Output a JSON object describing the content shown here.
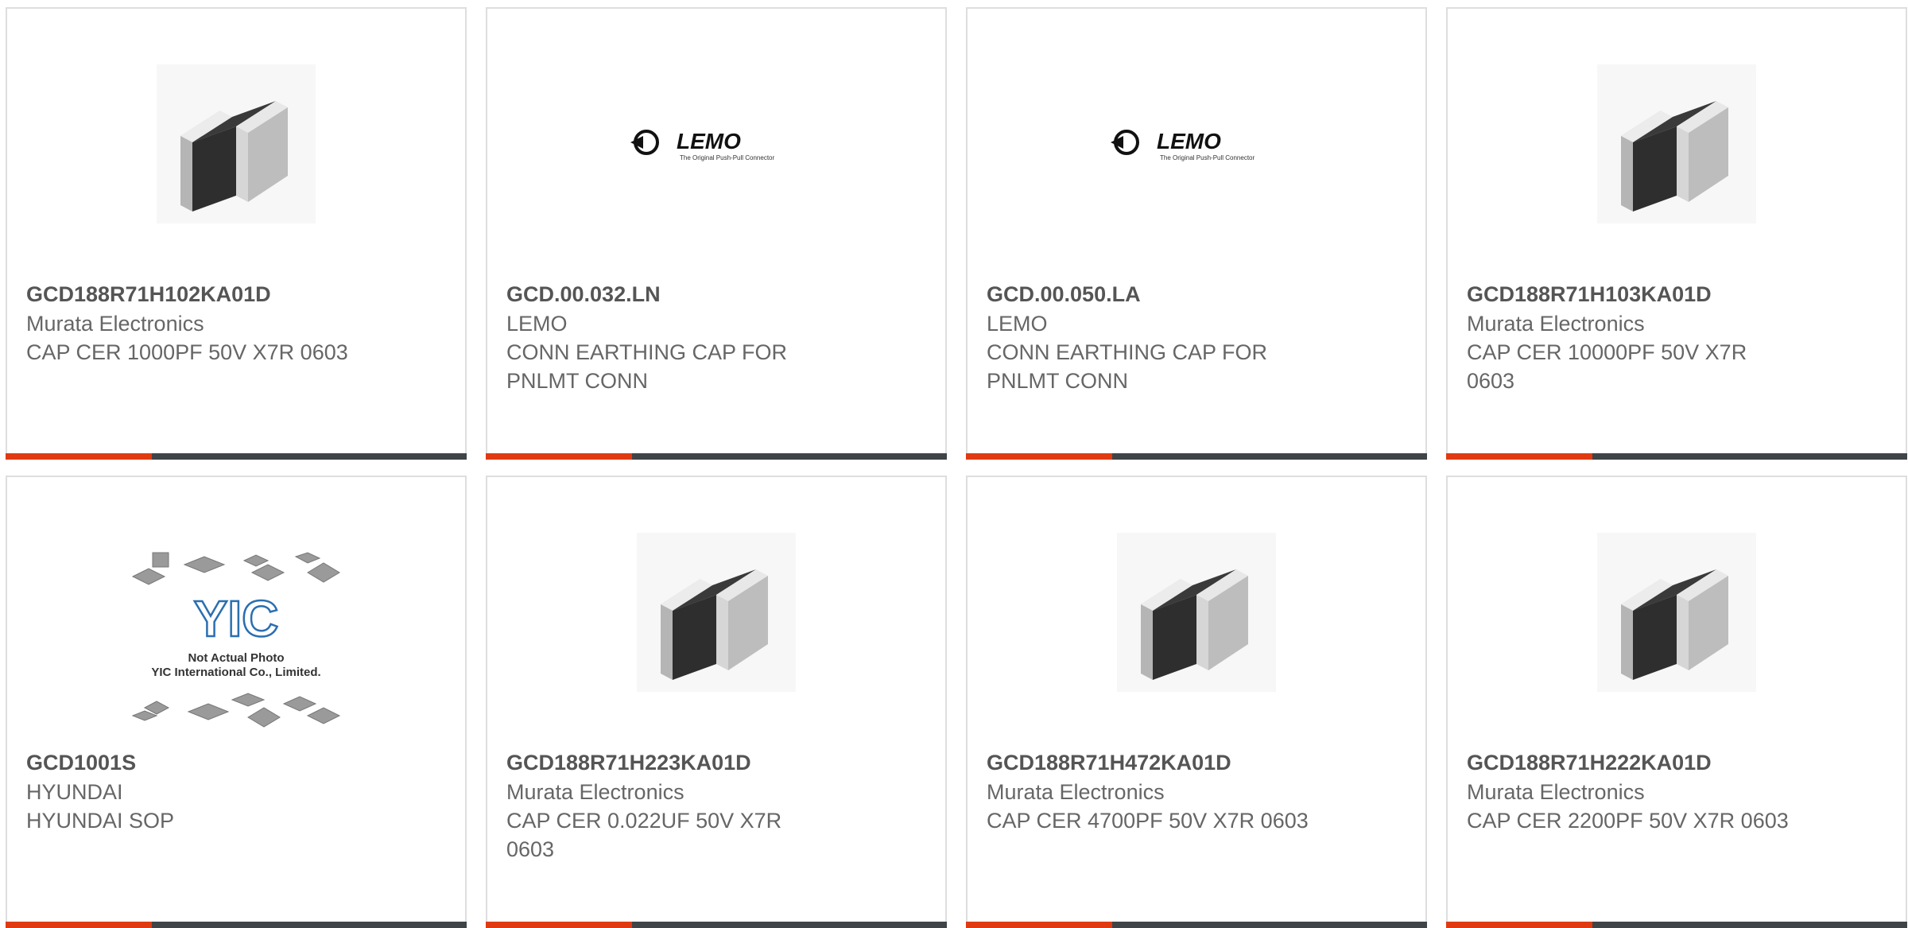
{
  "products": [
    {
      "part_number": "GCD188R71H102KA01D",
      "manufacturer": "Murata Electronics",
      "description": "CAP CER 1000PF 50V X7R 0603",
      "image": "chip-capacitor-icon"
    },
    {
      "part_number": "GCD.00.032.LN",
      "manufacturer": "LEMO",
      "description": "CONN EARTHING CAP FOR PNLMT CONN",
      "image": "lemo-logo",
      "logo_text": "LEMO",
      "logo_tagline": "The Original Push-Pull Connector"
    },
    {
      "part_number": "GCD.00.050.LA",
      "manufacturer": "LEMO",
      "description": "CONN EARTHING CAP FOR PNLMT CONN",
      "image": "lemo-logo",
      "logo_text": "LEMO",
      "logo_tagline": "The Original Push-Pull Connector"
    },
    {
      "part_number": "GCD188R71H103KA01D",
      "manufacturer": "Murata Electronics",
      "description": "CAP CER 10000PF 50V X7R 0603",
      "image": "chip-capacitor-icon"
    },
    {
      "part_number": "GCD1001S",
      "manufacturer": "HYUNDAI",
      "description": "HYUNDAI SOP",
      "image": "yic-placeholder",
      "placeholder_line1": "Not Actual Photo",
      "placeholder_line2": "YIC International Co., Limited.",
      "placeholder_logo": "YIC"
    },
    {
      "part_number": "GCD188R71H223KA01D",
      "manufacturer": "Murata Electronics",
      "description": "CAP CER 0.022UF 50V X7R 0603",
      "image": "chip-capacitor-icon"
    },
    {
      "part_number": "GCD188R71H472KA01D",
      "manufacturer": "Murata Electronics",
      "description": "CAP CER 4700PF 50V X7R 0603",
      "image": "chip-capacitor-icon"
    },
    {
      "part_number": "GCD188R71H222KA01D",
      "manufacturer": "Murata Electronics",
      "description": "CAP CER 2200PF 50V X7R 0603",
      "image": "chip-capacitor-icon"
    }
  ],
  "colors": {
    "accent": "#e03a12",
    "bar": "#3f4447",
    "border": "#dedede",
    "text": "#555555"
  }
}
